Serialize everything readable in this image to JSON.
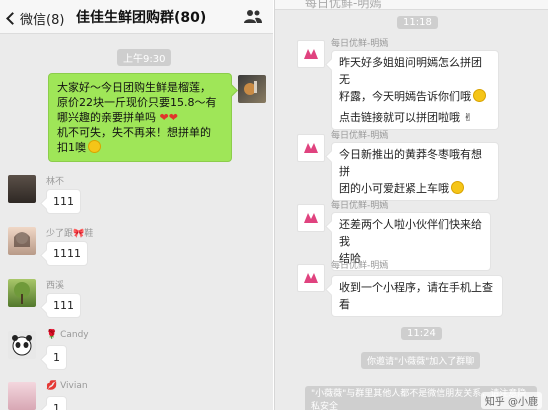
{
  "left": {
    "header": {
      "back_label": "微信(8)",
      "title": "佳佳生鲜团购群(80)",
      "people_icon": "group-people-icon"
    },
    "time_label": "上午9:30",
    "self_message": {
      "lines": [
        "大家好～今日团购生鲜是榴莲，",
        "原价22块一斤现价只要15.8～有",
        "哪兴趣的亲要拼单吗",
        "机不可失，失不再来！想拼单的",
        "扣1噢"
      ]
    },
    "messages": [
      {
        "nickname": "林不",
        "text": "111"
      },
      {
        "nickname": "少了跟🎀鞋",
        "text": "1111"
      },
      {
        "nickname": "西溪",
        "text": "111"
      },
      {
        "nickname": "Candy",
        "text": "1"
      },
      {
        "nickname": "Vivian",
        "text": "1"
      }
    ]
  },
  "right": {
    "header_title": "每日优鲜-明嫣",
    "time_top": "11:18",
    "sender": "每日优鲜-明嫣",
    "messages": [
      {
        "lines": [
          "昨天好多姐姐问明嫣怎么拼团无",
          "籽露，今天明嫣告诉你们哦"
        ],
        "extra": "点击链接就可以拼团啦哦"
      },
      {
        "lines": [
          "今日新推出的黄莽冬枣哦有想拼",
          "团的小可爱赶紧上车哦"
        ]
      },
      {
        "lines": [
          "还差两个人啦小伙伴们快来给我",
          "结哈"
        ]
      },
      {
        "lines": [
          "收到一个小程序，请在手机上查看"
        ]
      }
    ],
    "time_bottom": "11:24",
    "system_invite": "你邀请\"小薇薇\"加入了群聊",
    "system_notice": "\"小薇薇\"与群里其他人都不是微信朋友关系，请注意隐私安全",
    "watermark": "知乎 @小鹿"
  },
  "colors": {
    "self_bubble": "#9fe658",
    "chat_bg": "#ebebeb"
  }
}
